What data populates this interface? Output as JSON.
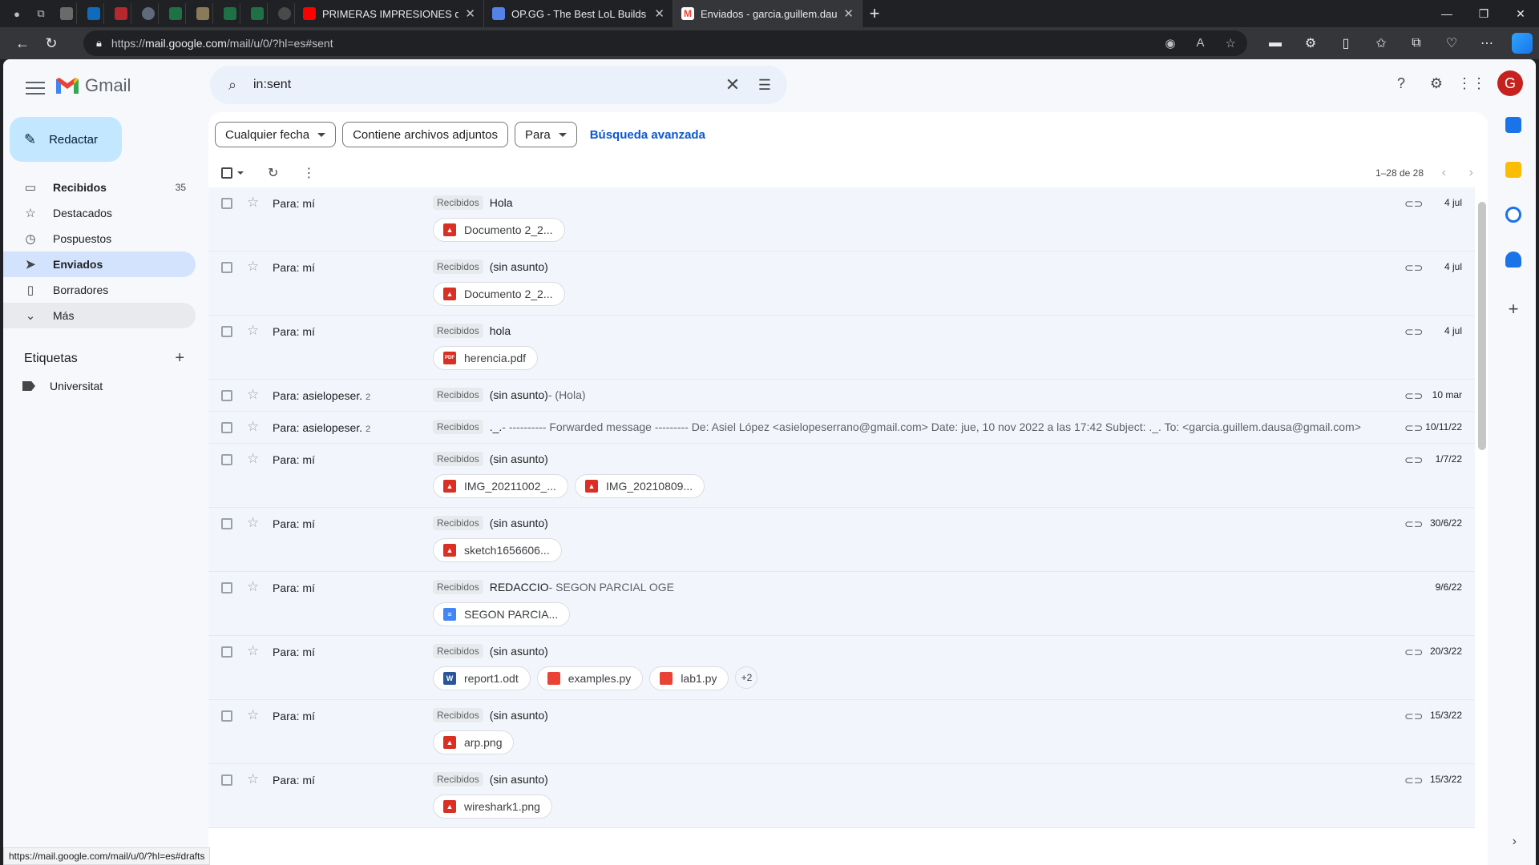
{
  "browser": {
    "tabs": [
      {
        "title": "PRIMERAS IMPRESIONES de K",
        "color": "#ff0000"
      },
      {
        "title": "OP.GG - The Best LoL Builds and",
        "color": "#5383e8"
      },
      {
        "title": "Enviados - garcia.guillem.dausa@",
        "color": "#ea4335"
      }
    ],
    "url_prefix": "https://",
    "url_host": "mail.google.com",
    "url_path": "/mail/u/0/?hl=es#sent"
  },
  "gmail": {
    "app_name": "Gmail",
    "search_query": "in:sent",
    "compose_label": "Redactar",
    "avatar_letter": "G",
    "nav": [
      {
        "label": "Recibidos",
        "icon": "inbox-icon",
        "count": "35",
        "active": false
      },
      {
        "label": "Destacados",
        "icon": "star-icon",
        "count": "",
        "active": false
      },
      {
        "label": "Pospuestos",
        "icon": "clock-icon",
        "count": "",
        "active": false
      },
      {
        "label": "Enviados",
        "icon": "send-icon",
        "count": "",
        "active": true
      },
      {
        "label": "Borradores",
        "icon": "draft-icon",
        "count": "",
        "active": false
      },
      {
        "label": "Más",
        "icon": "chevron-down-icon",
        "count": "",
        "active": false
      }
    ],
    "labels_header": "Etiquetas",
    "labels": [
      "Universitat"
    ],
    "filters": {
      "date": "Cualquier fecha",
      "attachments": "Contiene archivos adjuntos",
      "to": "Para",
      "advanced": "Búsqueda avanzada"
    },
    "pager": "1–28 de 28",
    "emails": [
      {
        "sender": "Para: mí",
        "count": "",
        "badge": "Recibidos",
        "subject": "Hola",
        "snippet": "",
        "date": "4 jul",
        "attach": true,
        "files": [
          {
            "name": "Documento 2_2...",
            "type": "img"
          }
        ]
      },
      {
        "sender": "Para: mí",
        "count": "",
        "badge": "Recibidos",
        "subject": "(sin asunto)",
        "snippet": "",
        "date": "4 jul",
        "attach": true,
        "files": [
          {
            "name": "Documento 2_2...",
            "type": "img"
          }
        ]
      },
      {
        "sender": "Para: mí",
        "count": "",
        "badge": "Recibidos",
        "subject": "hola",
        "snippet": "",
        "date": "4 jul",
        "attach": true,
        "files": [
          {
            "name": "herencia.pdf",
            "type": "pdf"
          }
        ]
      },
      {
        "sender": "Para: asielopeser.",
        "count": "2",
        "badge": "Recibidos",
        "subject": "(sin asunto)",
        "snippet": " - (Hola)",
        "date": "10 mar",
        "attach": true,
        "files": []
      },
      {
        "sender": "Para: asielopeser.",
        "count": "2",
        "badge": "Recibidos",
        "subject": "._.",
        "snippet": " - ---------- Forwarded message --------- De: Asiel López <asielopeserrano@gmail.com> Date: jue, 10 nov 2022 a las 17:42 Subject: ._. To: <garcia.guillem.dausa@gmail.com>",
        "date": "10/11/22",
        "attach": true,
        "files": []
      },
      {
        "sender": "Para: mí",
        "count": "",
        "badge": "Recibidos",
        "subject": "(sin asunto)",
        "snippet": "",
        "date": "1/7/22",
        "attach": true,
        "files": [
          {
            "name": "IMG_20211002_...",
            "type": "img"
          },
          {
            "name": "IMG_20210809...",
            "type": "img"
          }
        ]
      },
      {
        "sender": "Para: mí",
        "count": "",
        "badge": "Recibidos",
        "subject": "(sin asunto)",
        "snippet": "",
        "date": "30/6/22",
        "attach": true,
        "files": [
          {
            "name": "sketch1656606...",
            "type": "img"
          }
        ]
      },
      {
        "sender": "Para: mí",
        "count": "",
        "badge": "Recibidos",
        "subject": "REDACCIO",
        "snippet": " - SEGON PARCIAL OGE",
        "date": "9/6/22",
        "attach": false,
        "files": [
          {
            "name": "SEGON PARCIA...",
            "type": "doc"
          }
        ]
      },
      {
        "sender": "Para: mí",
        "count": "",
        "badge": "Recibidos",
        "subject": "(sin asunto)",
        "snippet": "",
        "date": "20/3/22",
        "attach": true,
        "files": [
          {
            "name": "report1.odt",
            "type": "w"
          },
          {
            "name": "examples.py",
            "type": "code"
          },
          {
            "name": "lab1.py",
            "type": "code"
          }
        ],
        "more": "+2"
      },
      {
        "sender": "Para: mí",
        "count": "",
        "badge": "Recibidos",
        "subject": "(sin asunto)",
        "snippet": "",
        "date": "15/3/22",
        "attach": true,
        "files": [
          {
            "name": "arp.png",
            "type": "img"
          }
        ]
      },
      {
        "sender": "Para: mí",
        "count": "",
        "badge": "Recibidos",
        "subject": "(sin asunto)",
        "snippet": "",
        "date": "15/3/22",
        "attach": true,
        "files": [
          {
            "name": "wireshark1.png",
            "type": "img"
          }
        ]
      }
    ],
    "status_url": "https://mail.google.com/mail/u/0/?hl=es#drafts"
  }
}
